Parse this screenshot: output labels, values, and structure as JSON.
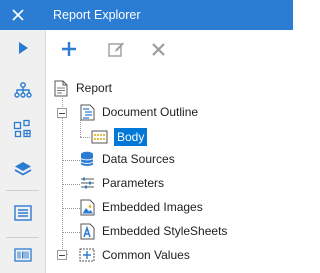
{
  "window": {
    "title": "Report Explorer",
    "close_icon": "close-icon"
  },
  "sidebar": {
    "items": [
      {
        "name": "preview-icon",
        "active": true
      },
      {
        "name": "hierarchy-icon"
      },
      {
        "name": "group-icon"
      },
      {
        "name": "layers-icon"
      },
      {
        "name": "form-icon"
      },
      {
        "name": "barcode-icon"
      }
    ]
  },
  "toolbar": {
    "add_icon": "plus-icon",
    "edit_icon": "pencil-icon",
    "delete_icon": "x-icon"
  },
  "tree": {
    "root": "Report",
    "document_outline": "Document Outline",
    "body": "Body",
    "data_sources": "Data Sources",
    "parameters": "Parameters",
    "embedded_images": "Embedded Images",
    "embedded_stylesheets": "Embedded StyleSheets",
    "common_values": "Common Values"
  },
  "colors": {
    "accent": "#2b7cd3",
    "selection": "#0078d7"
  }
}
